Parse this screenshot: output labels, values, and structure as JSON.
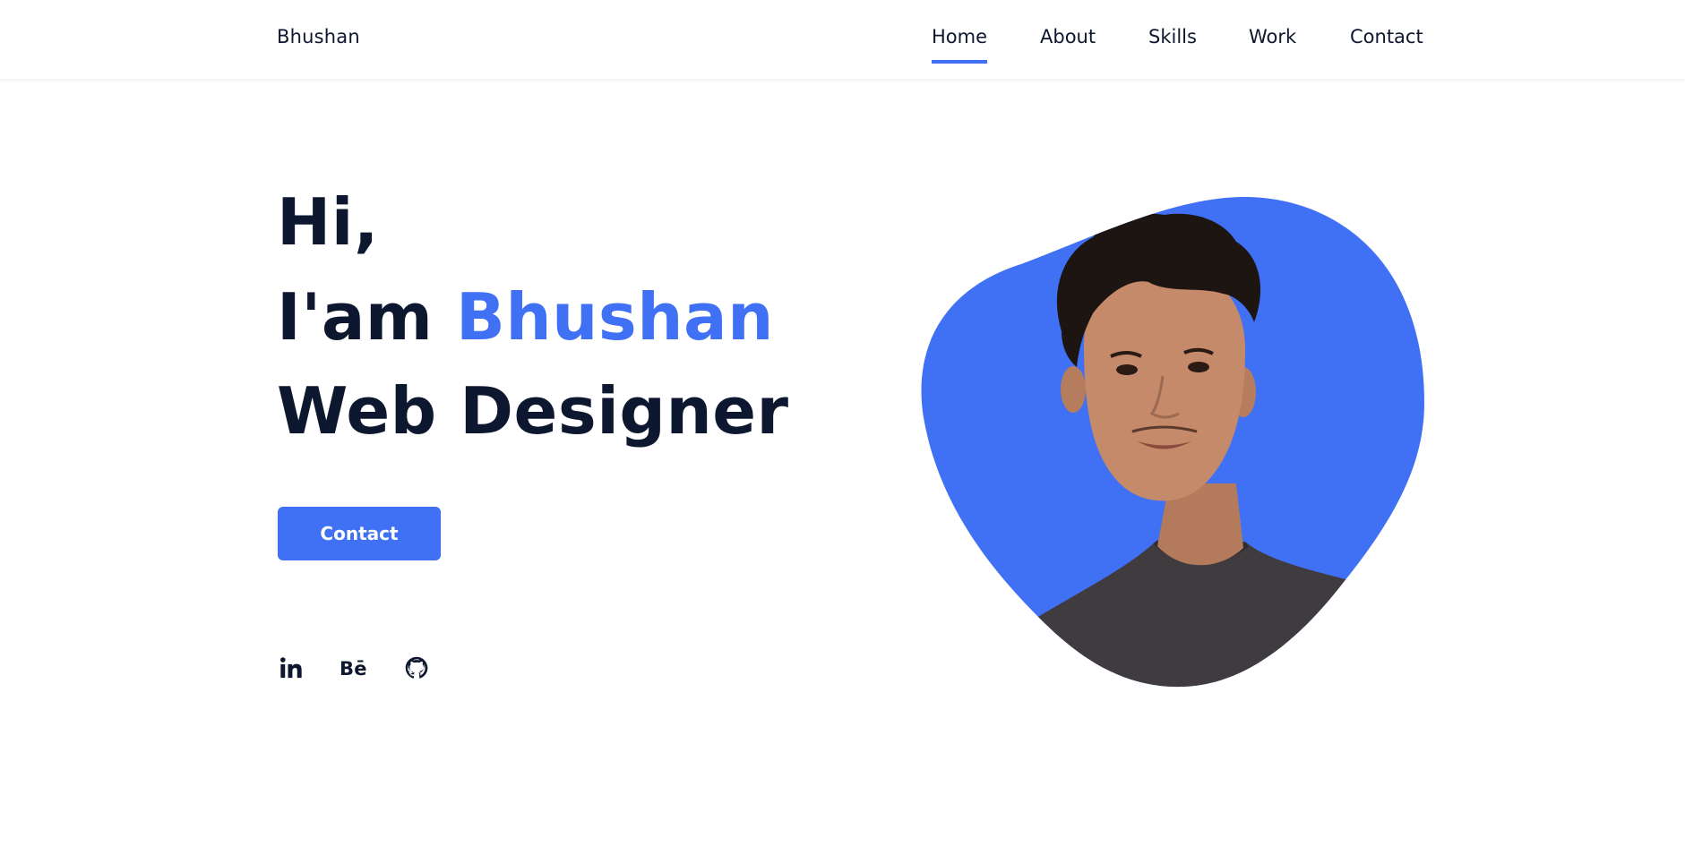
{
  "brand": "Bhushan",
  "nav": {
    "items": [
      {
        "label": "Home",
        "active": true
      },
      {
        "label": "About",
        "active": false
      },
      {
        "label": "Skills",
        "active": false
      },
      {
        "label": "Work",
        "active": false
      },
      {
        "label": "Contact",
        "active": false
      }
    ]
  },
  "hero": {
    "greeting": "Hi,",
    "intro_prefix": "I'am",
    "name": "Bhushan",
    "role": "Web Designer",
    "cta_label": "Contact"
  },
  "social": [
    {
      "icon": "linkedin-icon"
    },
    {
      "icon": "behance-icon",
      "text": "Bē"
    },
    {
      "icon": "github-icon"
    }
  ],
  "colors": {
    "accent": "#4070f4",
    "text": "#0e1730",
    "background": "#ffffff"
  }
}
